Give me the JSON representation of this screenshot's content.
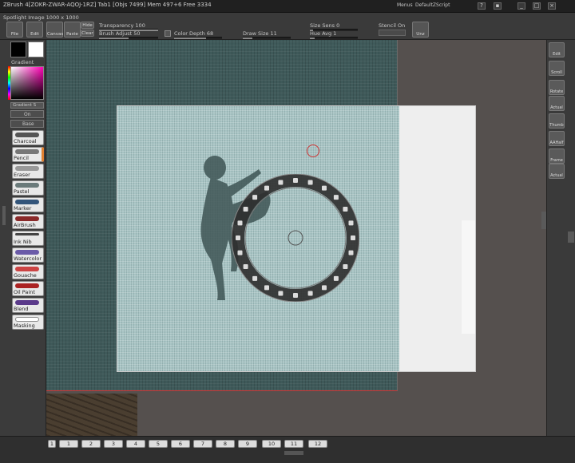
{
  "window": {
    "title": "ZBrush 4[ZOKR-ZWAR-AQOJ-1RZ]  Tab1  [Objs 7499] Mem 497+6 Free 3334",
    "menus_label": "Menus",
    "document_label": "DefaultZScript"
  },
  "toolbar": {
    "spotlight_label": "Spotlight Image 1000 x 1000",
    "transparency_label": "Transparency 100",
    "brush_adjust_label": "Brush Adjust 50",
    "color_depth_label": "Color Depth 68",
    "draw_size_label": "Draw Size 11",
    "size_sens_label": "Size Sens 0",
    "hue_label": "Hue Avg 1",
    "stencil_label": "Stencil On",
    "buttons": [
      "File",
      "Edit",
      "Canvas",
      "Paste",
      "Hide",
      "Clear",
      "Unz"
    ]
  },
  "left_panel": {
    "gradient_label": "Gradient",
    "switch_label": "Gradient S",
    "on_label": "On",
    "base_label": "Base",
    "brushes": [
      "Charcoal",
      "Pencil",
      "Eraser",
      "Pastel",
      "Marker",
      "AirBrush",
      "Ink Nib",
      "Watercolor",
      "Gouache",
      "Oil Paint",
      "Blend",
      "Masking"
    ]
  },
  "right_panel": {
    "buttons": [
      "Edit",
      "Scroll",
      "Rotate",
      "Actual",
      "Thumb",
      "AAHalf",
      "Frame",
      "Actual"
    ]
  },
  "bottom_tabs": [
    "1",
    "1",
    "2",
    "3",
    "4",
    "5",
    "6",
    "7",
    "8",
    "9",
    "10",
    "11",
    "12"
  ],
  "colors": {
    "accent_red": "#cc3333",
    "canvas_bg": "#55504e",
    "texture_light": "#a8c4c4"
  }
}
